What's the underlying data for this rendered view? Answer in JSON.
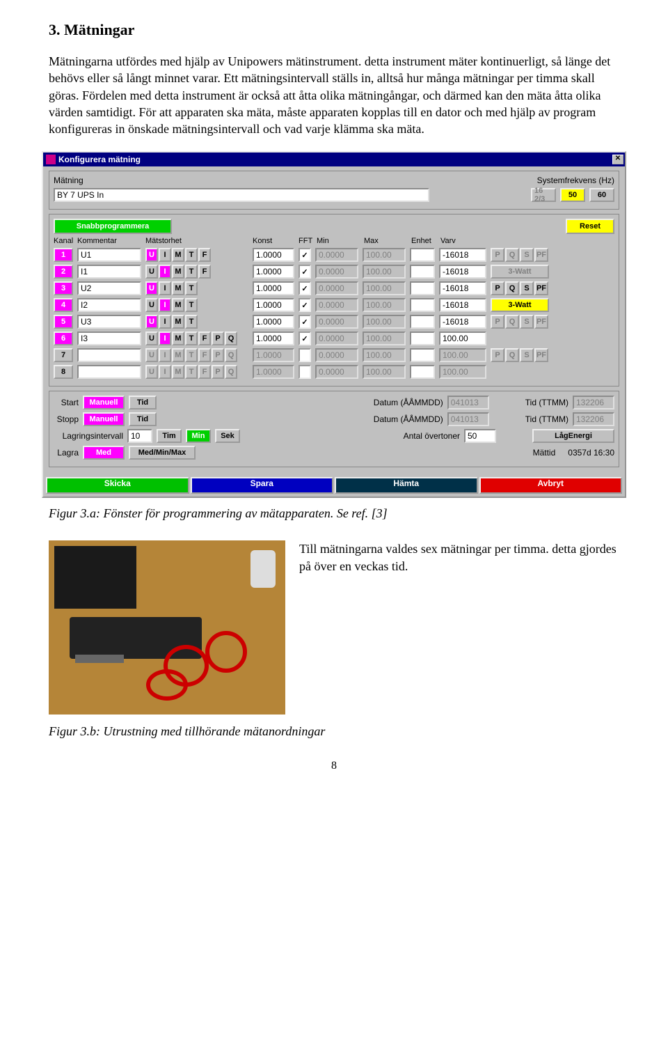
{
  "heading": "3. Mätningar",
  "body_text": "Mätningarna utfördes med hjälp av Unipowers mätinstrument. detta instrument mäter kontinuerligt, så länge det behövs eller så långt minnet varar. Ett mätningsintervall ställs in, alltså hur många mätningar per timma skall göras. Fördelen med detta instrument är också att åtta olika mätningångar, och därmed kan den mäta åtta olika värden samtidigt. För att apparaten ska mäta, måste apparaten kopplas till en dator och med hjälp av program konfigureras in önskade mätningsintervall och vad varje klämma ska mäta.",
  "dialog": {
    "title": "Konfigurera mätning",
    "matning_label": "Mätning",
    "matning_value": "BY 7 UPS In",
    "sysfreq_label": "Systemfrekvens (Hz)",
    "freq_options": [
      "16 2/3",
      "50",
      "60"
    ],
    "snabb_btn": "Snabbprogrammera",
    "reset_btn": "Reset",
    "headers": {
      "kanal": "Kanal",
      "komment": "Kommentar",
      "matstorhet": "Mätstorhet",
      "konst": "Konst",
      "fft": "FFT",
      "min": "Min",
      "max": "Max",
      "enhet": "Enhet",
      "varv": "Varv"
    },
    "rows": [
      {
        "n": "1",
        "k": "U1",
        "sel": "U",
        "seq": [
          "U",
          "I",
          "M",
          "T",
          "F"
        ],
        "dis": [],
        "konst": "1.0000",
        "fft": true,
        "min": "0.0000",
        "max": "100.00",
        "enh": "",
        "varv": "-16018",
        "pqsel": "",
        "pq_type": "PQS",
        "active": true
      },
      {
        "n": "2",
        "k": "I1",
        "sel": "I",
        "seq": [
          "U",
          "I",
          "M",
          "T",
          "F"
        ],
        "dis": [],
        "konst": "1.0000",
        "fft": true,
        "min": "0.0000",
        "max": "100.00",
        "enh": "",
        "varv": "-16018",
        "pqsel": "",
        "pq_type": "3watt",
        "active": true
      },
      {
        "n": "3",
        "k": "U2",
        "sel": "U",
        "seq": [
          "U",
          "I",
          "M",
          "T"
        ],
        "dis": [],
        "konst": "1.0000",
        "fft": true,
        "min": "0.0000",
        "max": "100.00",
        "enh": "",
        "varv": "-16018",
        "pqsel": "",
        "pq_type": "PQSPF",
        "active": true
      },
      {
        "n": "4",
        "k": "I2",
        "sel": "I",
        "seq": [
          "U",
          "I",
          "M",
          "T"
        ],
        "dis": [],
        "konst": "1.0000",
        "fft": true,
        "min": "0.0000",
        "max": "100.00",
        "enh": "",
        "varv": "-16018",
        "pqsel": "3-Watt",
        "pq_type": "3wattsel",
        "active": true
      },
      {
        "n": "5",
        "k": "U3",
        "sel": "U",
        "seq": [
          "U",
          "I",
          "M",
          "T"
        ],
        "dis": [],
        "konst": "1.0000",
        "fft": true,
        "min": "0.0000",
        "max": "100.00",
        "enh": "",
        "varv": "-16018",
        "pqsel": "",
        "pq_type": "PQS",
        "active": true
      },
      {
        "n": "6",
        "k": "I3",
        "sel": "I",
        "seq": [
          "U",
          "I",
          "M",
          "T",
          "F",
          "P",
          "Q"
        ],
        "dis": [],
        "konst": "1.0000",
        "fft": true,
        "min": "0.0000",
        "max": "100.00",
        "enh": "",
        "varv": "100.00",
        "pqsel": "",
        "pq_type": "none",
        "active": true
      },
      {
        "n": "7",
        "k": "",
        "sel": "",
        "seq": [
          "U",
          "I",
          "M",
          "T",
          "F",
          "P",
          "Q"
        ],
        "dis": [
          "U",
          "I",
          "M",
          "T",
          "F",
          "P",
          "Q"
        ],
        "konst": "1.0000",
        "fft": false,
        "min": "0.0000",
        "max": "100.00",
        "enh": "",
        "varv": "100.00",
        "pqsel": "",
        "pq_type": "PQS",
        "active": false
      },
      {
        "n": "8",
        "k": "",
        "sel": "",
        "seq": [
          "U",
          "I",
          "M",
          "T",
          "F",
          "P",
          "Q"
        ],
        "dis": [
          "U",
          "I",
          "M",
          "T",
          "F",
          "P",
          "Q"
        ],
        "konst": "1.0000",
        "fft": false,
        "min": "0.0000",
        "max": "100.00",
        "enh": "",
        "varv": "100.00",
        "pqsel": "",
        "pq_type": "none",
        "active": false
      }
    ],
    "timing": {
      "start_lbl": "Start",
      "stopp_lbl": "Stopp",
      "manuell": "Manuell",
      "tid": "Tid",
      "datum_lbl": "Datum (ÅÅMMDD)",
      "datum_val": "041013",
      "tid_lbl": "Tid (TTMM)",
      "tid_val": "132206",
      "lagrint_lbl": "Lagringsintervall",
      "lagrint_val": "10",
      "tim": "Tim",
      "min": "Min",
      "sek": "Sek",
      "antal_lbl": "Antal övertoner",
      "antal_val": "50",
      "lagenergi": "LågEnergi",
      "lagra_lbl": "Lagra",
      "med": "Med",
      "mmx": "Med/Min/Max",
      "mattid_lbl": "Mättid",
      "mattid_val": "0357d 16:30"
    },
    "bottom": {
      "skicka": "Skicka",
      "spara": "Spara",
      "hamta": "Hämta",
      "avbryt": "Avbryt"
    }
  },
  "fig_a": "Figur 3.a: Fönster för programmering av mätapparaten. Se ref. [3]",
  "photo_text": "Till mätningarna valdes sex mätningar per timma. detta gjordes på över en veckas tid.",
  "fig_b": "Figur 3.b: Utrustning med tillhörande mätanordningar",
  "page_num": "8"
}
